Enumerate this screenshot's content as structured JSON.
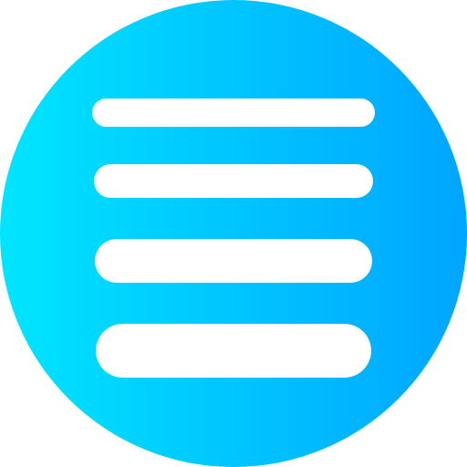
{
  "icon": {
    "name": "menu-lines-icon",
    "style": "gradient circle with four white rounded bars",
    "bar_count": 4,
    "colors": {
      "gradient_start": "#00E5FF",
      "gradient_end": "#00A5FF",
      "bars": "#FFFFFF"
    }
  }
}
